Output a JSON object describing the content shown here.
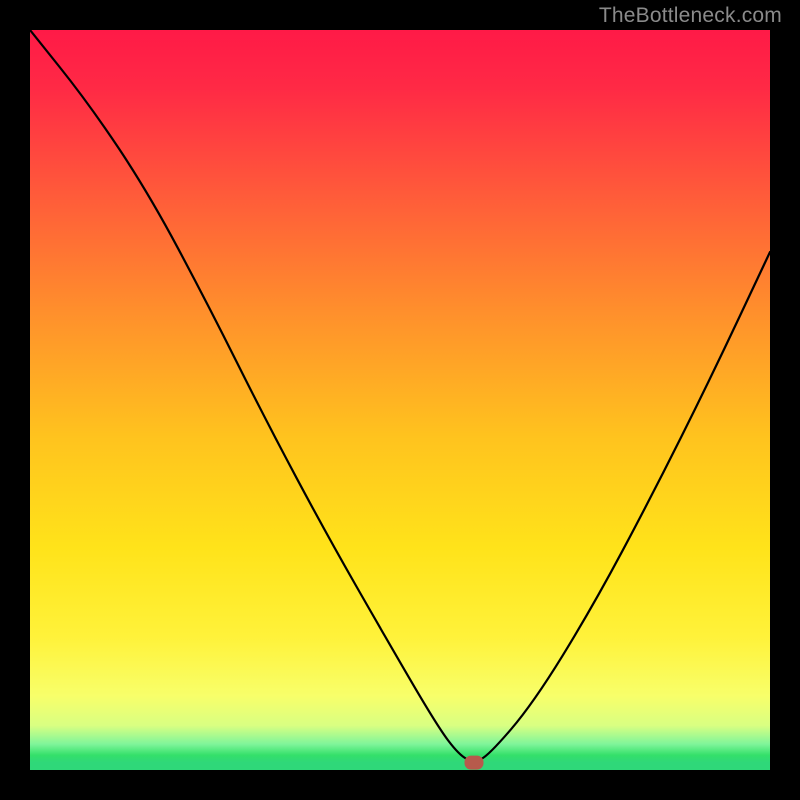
{
  "attribution": "TheBottleneck.com",
  "chart_data": {
    "type": "line",
    "title": "",
    "xlabel": "",
    "ylabel": "",
    "xlim": [
      0,
      100
    ],
    "ylim": [
      0,
      100
    ],
    "series": [
      {
        "name": "bottleneck-curve",
        "x": [
          0,
          8,
          16,
          24,
          32,
          40,
          48,
          55,
          58,
          60,
          62,
          68,
          76,
          84,
          92,
          100
        ],
        "y": [
          100,
          90,
          78,
          63,
          47,
          32,
          18,
          6,
          2,
          1,
          2,
          9,
          22,
          37,
          53,
          70
        ]
      }
    ],
    "marker": {
      "x": 60,
      "y": 1
    },
    "gradient_stops": [
      {
        "pos": 0,
        "color": "#ff1a47"
      },
      {
        "pos": 0.55,
        "color": "#ffc31e"
      },
      {
        "pos": 0.9,
        "color": "#f8ff6a"
      },
      {
        "pos": 1.0,
        "color": "#2fd879"
      }
    ]
  }
}
